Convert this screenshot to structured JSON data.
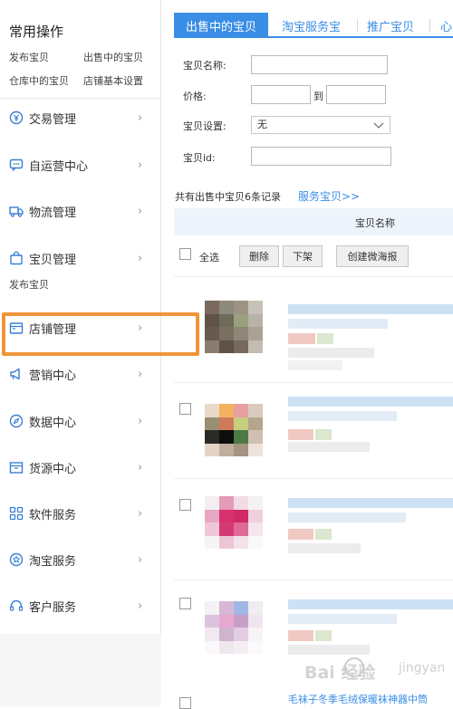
{
  "sidebar": {
    "common_title": "常用操作",
    "quick_links": [
      "发布宝贝",
      "出售中的宝贝",
      "仓库中的宝贝",
      "店铺基本设置"
    ],
    "nav_items": [
      {
        "label": "交易管理",
        "icon": "currency-circle-icon"
      },
      {
        "label": "自运营中心",
        "icon": "chat-bubble-icon"
      },
      {
        "label": "物流管理",
        "icon": "truck-icon"
      },
      {
        "label": "宝贝管理",
        "icon": "bag-icon"
      },
      {
        "label": "店铺管理",
        "icon": "store-icon"
      },
      {
        "label": "营销中心",
        "icon": "megaphone-icon"
      },
      {
        "label": "数据中心",
        "icon": "compass-icon"
      },
      {
        "label": "货源中心",
        "icon": "box-icon"
      },
      {
        "label": "软件服务",
        "icon": "grid-icon"
      },
      {
        "label": "淘宝服务",
        "icon": "star-badge-icon"
      },
      {
        "label": "客户服务",
        "icon": "headset-icon"
      }
    ],
    "chevron": "›",
    "sub_link": "发布宝贝"
  },
  "tabs": [
    "出售中的宝贝",
    "淘宝服务宝",
    "推广宝贝",
    "心"
  ],
  "form": {
    "name_label": "宝贝名称:",
    "price_label": "价格:",
    "range_sep": "到",
    "setting_label": "宝贝设置:",
    "setting_value": "无",
    "id_label": "宝贝id:"
  },
  "summary": {
    "count_text": "共有出售中宝贝6条记录",
    "service_link": "服务宝贝>>"
  },
  "table": {
    "header": "宝贝名称",
    "select_all": "全选",
    "buttons": [
      "删除",
      "下架",
      "创建微海报"
    ],
    "last_title": "毛袜子冬季毛绒保暖袜神器中筒"
  },
  "watermark": {
    "text": "Bai  经验",
    "sub": "jingyan"
  },
  "colors": {
    "accent": "#3a8ee6",
    "highlight": "#f0943a"
  }
}
